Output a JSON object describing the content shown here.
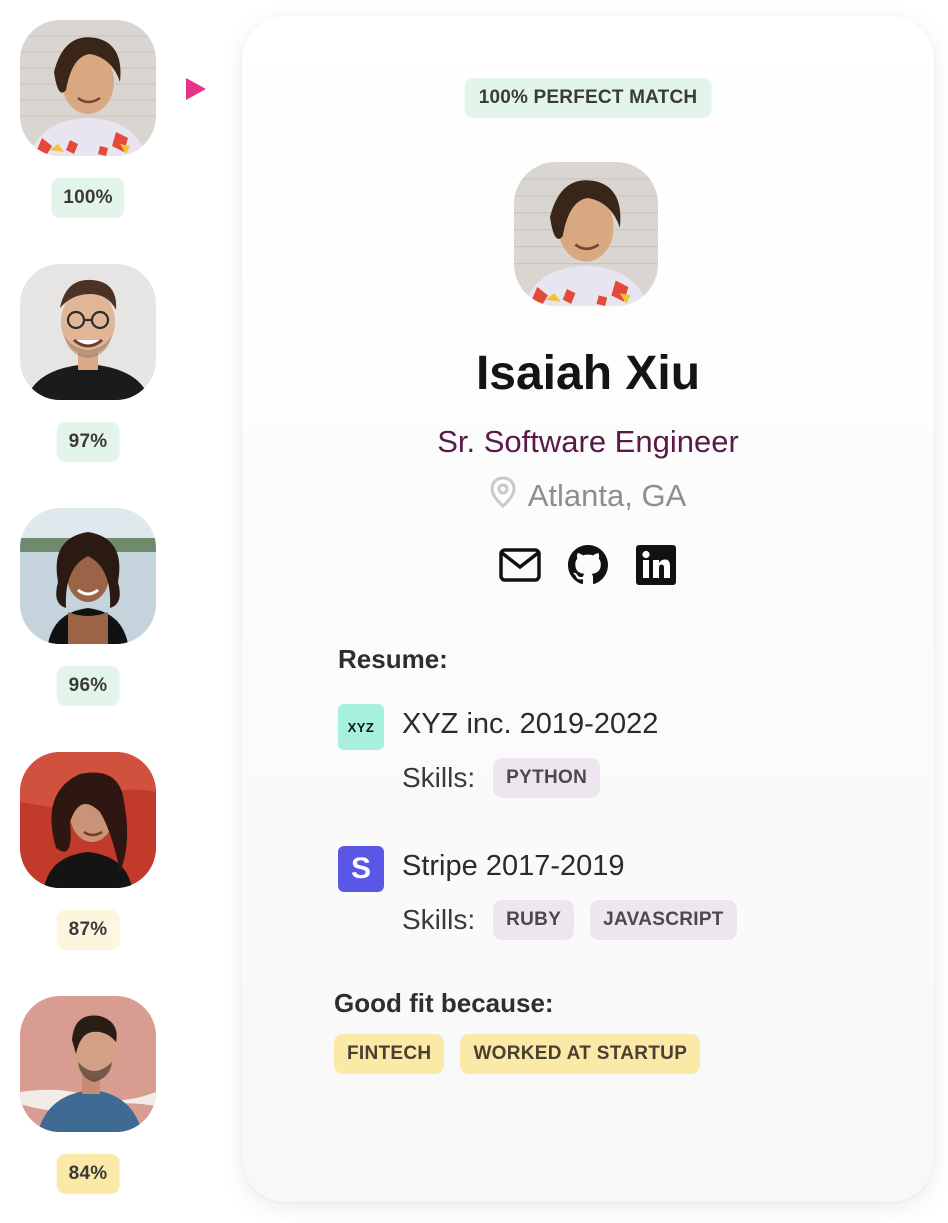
{
  "candidates": [
    {
      "match": "100%",
      "tone": "green"
    },
    {
      "match": "97%",
      "tone": "green"
    },
    {
      "match": "96%",
      "tone": "green"
    },
    {
      "match": "87%",
      "tone": "cream"
    },
    {
      "match": "84%",
      "tone": "yellow"
    }
  ],
  "profile": {
    "match_badge": "100% PERFECT MATCH",
    "name": "Isaiah Xiu",
    "title": "Sr. Software Engineer",
    "location": "Atlanta, GA",
    "location_icon": "map-pin-icon",
    "social_icons": [
      "mail-icon",
      "github-icon",
      "linkedin-icon"
    ]
  },
  "resume": {
    "heading": "Resume:",
    "skills_label": "Skills:",
    "jobs": [
      {
        "logo_text": "XYZ",
        "logo_color": "#a6f0dc",
        "title": "XYZ inc. 2019-2022",
        "skills": [
          "PYTHON"
        ]
      },
      {
        "logo_text": "S",
        "logo_color": "#5b57e6",
        "title": "Stripe 2017-2019",
        "skills": [
          "RUBY",
          "JAVASCRIPT"
        ]
      }
    ]
  },
  "fit": {
    "heading": "Good fit because:",
    "reasons": [
      "FINTECH",
      "WORKED AT STARTUP"
    ]
  },
  "colors": {
    "accent_pointer": "#e8338a",
    "title": "#5a1a48",
    "badge_green": "#e3f5ea",
    "chip_lilac": "#ede6ee",
    "chip_gold": "#fbe9a8"
  }
}
